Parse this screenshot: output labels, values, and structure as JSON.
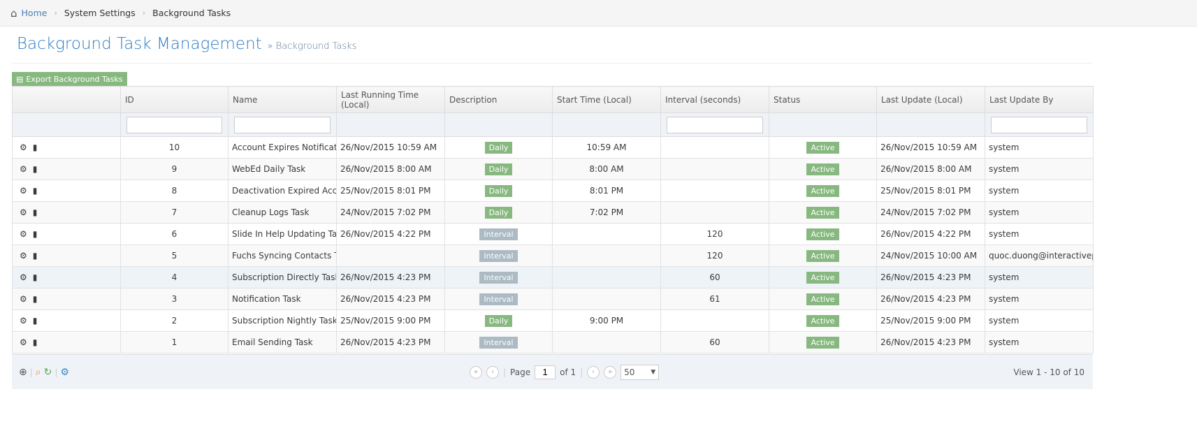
{
  "breadcrumb": {
    "home": "Home",
    "items": [
      "System Settings",
      "Background Tasks"
    ]
  },
  "page": {
    "title": "Background Task Management",
    "subtitle": "» Background Tasks"
  },
  "export_label": "Export Background Tasks",
  "columns": [
    "",
    "ID",
    "Name",
    "Last Running Time (Local)",
    "Description",
    "Start Time (Local)",
    "Interval (seconds)",
    "Status",
    "Last Update (Local)",
    "Last Update By"
  ],
  "colors": {
    "daily": "#87b87f",
    "interval": "#abbac3",
    "active": "#87b87f",
    "accent": "#2b7cc5"
  },
  "rows": [
    {
      "id": "10",
      "name": "Account Expires Notification",
      "last_run": "26/Nov/2015 10:59 AM",
      "desc": "Daily",
      "start": "10:59 AM",
      "interval": "",
      "status": "Active",
      "updated": "26/Nov/2015 10:59 AM",
      "by": "system"
    },
    {
      "id": "9",
      "name": "WebEd Daily Task",
      "last_run": "26/Nov/2015 8:00 AM",
      "desc": "Daily",
      "start": "8:00 AM",
      "interval": "",
      "status": "Active",
      "updated": "26/Nov/2015 8:00 AM",
      "by": "system"
    },
    {
      "id": "8",
      "name": "Deactivation Expired Accou",
      "last_run": "25/Nov/2015 8:01 PM",
      "desc": "Daily",
      "start": "8:01 PM",
      "interval": "",
      "status": "Active",
      "updated": "25/Nov/2015 8:01 PM",
      "by": "system"
    },
    {
      "id": "7",
      "name": "Cleanup Logs Task",
      "last_run": "24/Nov/2015 7:02 PM",
      "desc": "Daily",
      "start": "7:02 PM",
      "interval": "",
      "status": "Active",
      "updated": "24/Nov/2015 7:02 PM",
      "by": "system"
    },
    {
      "id": "6",
      "name": "Slide In Help Updating Task",
      "last_run": "26/Nov/2015 4:22 PM",
      "desc": "Interval",
      "start": "",
      "interval": "120",
      "status": "Active",
      "updated": "26/Nov/2015 4:22 PM",
      "by": "system"
    },
    {
      "id": "5",
      "name": "Fuchs Syncing Contacts Tas",
      "last_run": "",
      "desc": "Interval",
      "start": "",
      "interval": "120",
      "status": "Active",
      "updated": "24/Nov/2015 10:00 AM",
      "by": "quoc.duong@interactivepa"
    },
    {
      "id": "4",
      "name": "Subscription Directly Task",
      "last_run": "26/Nov/2015 4:23 PM",
      "desc": "Interval",
      "start": "",
      "interval": "60",
      "status": "Active",
      "updated": "26/Nov/2015 4:23 PM",
      "by": "system"
    },
    {
      "id": "3",
      "name": "Notification Task",
      "last_run": "26/Nov/2015 4:23 PM",
      "desc": "Interval",
      "start": "",
      "interval": "61",
      "status": "Active",
      "updated": "26/Nov/2015 4:23 PM",
      "by": "system"
    },
    {
      "id": "2",
      "name": "Subscription Nightly Task",
      "last_run": "25/Nov/2015 9:00 PM",
      "desc": "Daily",
      "start": "9:00 PM",
      "interval": "",
      "status": "Active",
      "updated": "25/Nov/2015 9:00 PM",
      "by": "system"
    },
    {
      "id": "1",
      "name": "Email Sending Task",
      "last_run": "26/Nov/2015 4:23 PM",
      "desc": "Interval",
      "start": "",
      "interval": "60",
      "status": "Active",
      "updated": "26/Nov/2015 4:23 PM",
      "by": "system"
    }
  ],
  "pager": {
    "page_label": "Page",
    "page": "1",
    "of_label": "of 1",
    "page_size": "50",
    "view": "View 1 - 10 of 10"
  }
}
